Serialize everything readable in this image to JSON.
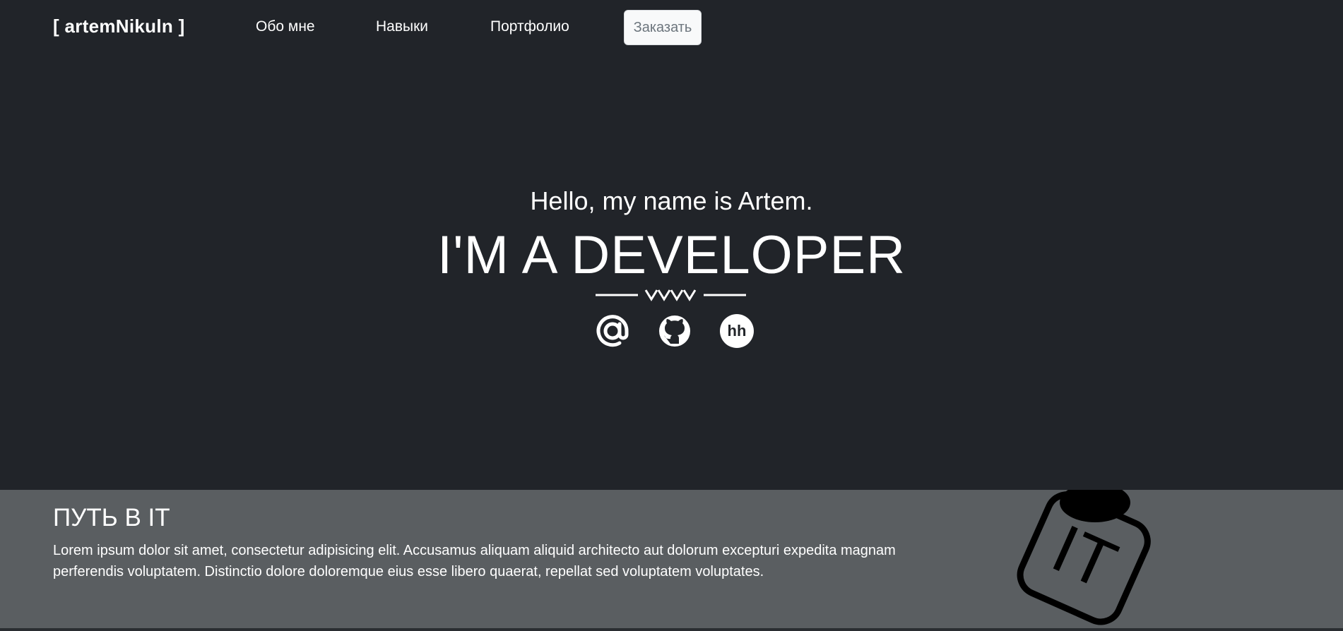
{
  "nav": {
    "brand": "[ artemNikuln ]",
    "links": [
      {
        "label": "Обо мне"
      },
      {
        "label": "Навыки"
      },
      {
        "label": "Портфолио"
      }
    ],
    "order_label": "Заказать"
  },
  "hero": {
    "greeting": "Hello, my name is Artem.",
    "title": "I'M A DEVELOPER",
    "socials": [
      {
        "icon": "at-sign-icon"
      },
      {
        "icon": "github-icon"
      },
      {
        "icon": "hh-icon",
        "text": "hh"
      }
    ]
  },
  "about": {
    "heading": "ПУТЬ В IT",
    "text": "Lorem ipsum dolor sit amet, consectetur adipisicing elit. Accusamus aliquam aliquid architecto aut dolorum excepturi expedita magnam perferendis voluptatem. Distinctio dolore doloremque eius esse libero quaerat, repellat sed voluptatem voluptates.",
    "art_text": "IT"
  },
  "colors": {
    "hero_bg": "#212429",
    "about_bg": "#5a5e61",
    "button_bg": "#f8f9fa",
    "button_text": "#6c757d"
  }
}
